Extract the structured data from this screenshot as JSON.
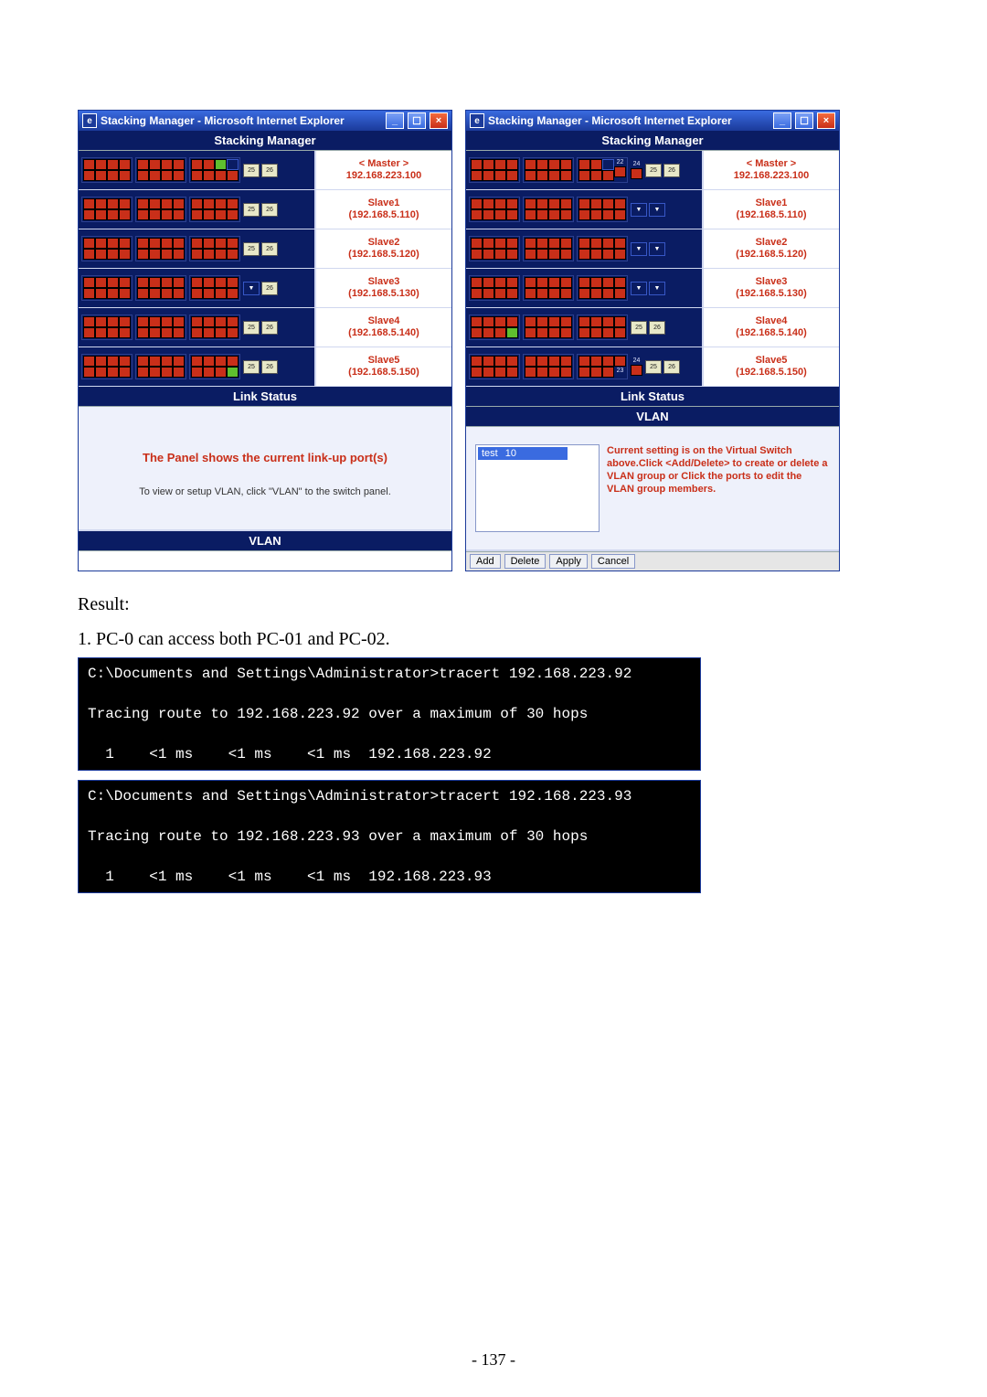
{
  "win": {
    "title": "Stacking Manager - Microsoft Internet Explorer",
    "min": "_",
    "max": "☐",
    "close": "×"
  },
  "app": {
    "header": "Stacking Manager",
    "link_status": "Link Status",
    "vlan": "VLAN"
  },
  "devices": [
    {
      "name": "< Master >",
      "ip": "192.168.223.100"
    },
    {
      "name": "Slave1",
      "ip": "(192.168.5.110)"
    },
    {
      "name": "Slave2",
      "ip": "(192.168.5.120)"
    },
    {
      "name": "Slave3",
      "ip": "(192.168.5.130)"
    },
    {
      "name": "Slave4",
      "ip": "(192.168.5.140)"
    },
    {
      "name": "Slave5",
      "ip": "(192.168.5.150)"
    }
  ],
  "left_lower": {
    "line1": "The Panel shows the current link-up port(s)",
    "line2": "To view or setup VLAN, click \"VLAN\" to the switch panel."
  },
  "right_vlan": {
    "item_name": "test",
    "item_id": "10",
    "help": "Current setting is on the Virtual Switch above.Click <Add/Delete> to create or delete a VLAN group or Click the ports to edit the VLAN group members."
  },
  "buttons": {
    "add": "Add",
    "delete": "Delete",
    "apply": "Apply",
    "cancel": "Cancel"
  },
  "result_label": "Result:",
  "result_line": "1. PC-0 can access both PC-01 and PC-02.",
  "term1": {
    "l1": "C:\\Documents and Settings\\Administrator>tracert 192.168.223.92",
    "l2": "Tracing route to 192.168.223.92 over a maximum of 30 hops",
    "l3": "  1    <1 ms    <1 ms    <1 ms  192.168.223.92"
  },
  "term2": {
    "l1": "C:\\Documents and Settings\\Administrator>tracert 192.168.223.93",
    "l2": "Tracing route to 192.168.223.93 over a maximum of 30 hops",
    "l3": "  1    <1 ms    <1 ms    <1 ms  192.168.223.93"
  },
  "page_num": "- 137 -"
}
